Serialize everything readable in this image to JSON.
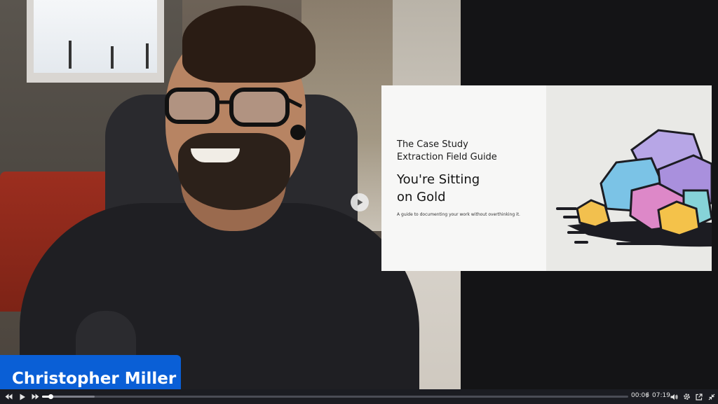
{
  "speaker": {
    "name": "Christopher Miller"
  },
  "slide": {
    "kicker_line1": "The Case Study",
    "kicker_line2": "Extraction Field Guide",
    "title_line1": "You're Sitting",
    "title_line2": "on Gold",
    "subtitle": "A guide to documenting your work without overthinking it."
  },
  "controls": {
    "current_time": "00:06",
    "separator": "/",
    "duration": "07:19",
    "progress_fraction": 0.014,
    "buffered_fraction": 0.09,
    "icons": {
      "rewind": "rewind-icon",
      "play": "play-icon",
      "forward": "fast-forward-icon",
      "volume": "volume-icon",
      "settings": "gear-icon",
      "popout": "popout-icon",
      "minimize": "minimize-icon"
    }
  },
  "colors": {
    "nametag_bg": "#0a5fd6",
    "control_bar_bg": "#1b1c22"
  }
}
